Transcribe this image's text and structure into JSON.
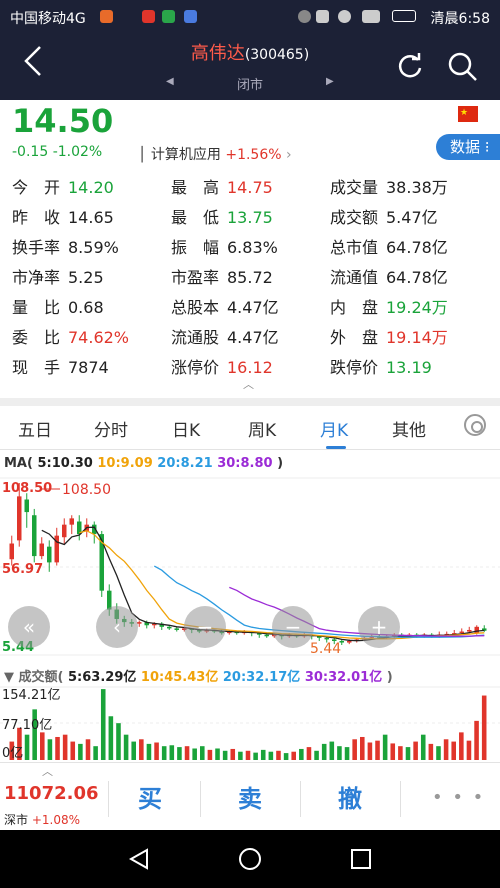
{
  "status_bar": {
    "carrier": "中国移动4G",
    "right": "清晨6:58",
    "net": "4G"
  },
  "header": {
    "stock_name": "高伟达",
    "stock_code": "(300465)",
    "market_status": "闭市",
    "back_icon": "chevron-left-icon",
    "refresh_icon": "refresh-icon",
    "search_icon": "search-icon"
  },
  "quote": {
    "price": "14.50",
    "change": "-0.15",
    "change_pct": "-1.02%",
    "sector_name": "计算机应用",
    "sector_pct": "+1.56%",
    "data_button": "数据",
    "flag_color": "#de2910",
    "rows": [
      [
        {
          "k": "今　开",
          "v": "14.20",
          "c": "dn"
        },
        {
          "k": "最　高",
          "v": "14.75",
          "c": "up"
        },
        {
          "k": "成交量",
          "v": "38.38万",
          "c": ""
        }
      ],
      [
        {
          "k": "昨　收",
          "v": "14.65",
          "c": ""
        },
        {
          "k": "最　低",
          "v": "13.75",
          "c": "dn"
        },
        {
          "k": "成交额",
          "v": "5.47亿",
          "c": ""
        }
      ],
      [
        {
          "k": "换手率",
          "v": "8.59%",
          "c": ""
        },
        {
          "k": "振　幅",
          "v": "6.83%",
          "c": ""
        },
        {
          "k": "总市值",
          "v": "64.78亿",
          "c": ""
        }
      ],
      [
        {
          "k": "市净率",
          "v": "5.25",
          "c": ""
        },
        {
          "k": "市盈率",
          "v": "85.72",
          "c": ""
        },
        {
          "k": "流通值",
          "v": "64.78亿",
          "c": ""
        }
      ],
      [
        {
          "k": "量　比",
          "v": "0.68",
          "c": ""
        },
        {
          "k": "总股本",
          "v": "4.47亿",
          "c": ""
        },
        {
          "k": "内　盘",
          "v": "19.24万",
          "c": "dn"
        }
      ],
      [
        {
          "k": "委　比",
          "v": "74.62%",
          "c": "up"
        },
        {
          "k": "流通股",
          "v": "4.47亿",
          "c": ""
        },
        {
          "k": "外　盘",
          "v": "19.14万",
          "c": "up"
        }
      ],
      [
        {
          "k": "现　手",
          "v": "7874",
          "c": ""
        },
        {
          "k": "涨停价",
          "v": "16.12",
          "c": "up"
        },
        {
          "k": "跌停价",
          "v": "13.19",
          "c": "dn"
        }
      ]
    ]
  },
  "tabs": [
    "五日",
    "分时",
    "日K",
    "周K",
    "月K",
    "其他"
  ],
  "active_tab": "月K",
  "ma_legend": {
    "prefix": "MA(",
    "ma5": "5:10.30",
    "ma10": "10:9.09",
    "ma20": "20:8.21",
    "ma30": "30:8.80",
    "suffix": ")"
  },
  "chart_labels": {
    "high_axis": "108.50",
    "high_mark": "108.50",
    "mid_axis": "56.97",
    "low_axis": "5.44",
    "low_mark": "5.44"
  },
  "vol_legend": {
    "prefix": "▼ 成交额(",
    "ma5": "5:63.29亿",
    "ma10": "10:45.43亿",
    "ma20": "20:32.17亿",
    "ma30": "30:32.01亿",
    "suffix": ")",
    "axis_top": "154.21亿",
    "axis_mid": "77.10亿",
    "axis_bot": "0亿"
  },
  "bottom": {
    "index_value": "11072.06",
    "index_name": "深市",
    "index_pct": "+1.08%",
    "buy": "买",
    "sell": "卖",
    "cancel": "撤",
    "more": "• • •"
  },
  "colors": {
    "up": "#e0352b",
    "down": "#1aa33a",
    "accent": "#2d7fd6",
    "ma5": "#222222",
    "ma10": "#f0a30a",
    "ma20": "#2b9be0",
    "ma30": "#9b2bd6"
  },
  "chart_data": {
    "type": "candlestick",
    "ylim": [
      5.44,
      108.5
    ],
    "candles": [
      {
        "o": 60,
        "c": 70,
        "h": 75,
        "l": 56
      },
      {
        "o": 72,
        "c": 100,
        "h": 108.5,
        "l": 68
      },
      {
        "o": 98,
        "c": 90,
        "h": 102,
        "l": 80
      },
      {
        "o": 88,
        "c": 62,
        "h": 92,
        "l": 58
      },
      {
        "o": 62,
        "c": 70,
        "h": 74,
        "l": 60
      },
      {
        "o": 68,
        "c": 58,
        "h": 72,
        "l": 52
      },
      {
        "o": 58,
        "c": 75,
        "h": 80,
        "l": 56
      },
      {
        "o": 74,
        "c": 82,
        "h": 86,
        "l": 70
      },
      {
        "o": 82,
        "c": 86,
        "h": 88,
        "l": 76
      },
      {
        "o": 84,
        "c": 76,
        "h": 88,
        "l": 72
      },
      {
        "o": 78,
        "c": 82,
        "h": 86,
        "l": 74
      },
      {
        "o": 82,
        "c": 76,
        "h": 84,
        "l": 70
      },
      {
        "o": 76,
        "c": 40,
        "h": 78,
        "l": 36
      },
      {
        "o": 40,
        "c": 28,
        "h": 44,
        "l": 24
      },
      {
        "o": 28,
        "c": 22,
        "h": 32,
        "l": 19
      },
      {
        "o": 22,
        "c": 20,
        "h": 24,
        "l": 17
      },
      {
        "o": 20,
        "c": 19,
        "h": 22,
        "l": 17
      },
      {
        "o": 19,
        "c": 20,
        "h": 21,
        "l": 17
      },
      {
        "o": 20,
        "c": 18,
        "h": 21,
        "l": 16
      },
      {
        "o": 18,
        "c": 19,
        "h": 20,
        "l": 16
      },
      {
        "o": 19,
        "c": 17,
        "h": 20,
        "l": 15
      },
      {
        "o": 17,
        "c": 16,
        "h": 18,
        "l": 15
      },
      {
        "o": 16,
        "c": 15,
        "h": 17,
        "l": 14
      },
      {
        "o": 15,
        "c": 16,
        "h": 17,
        "l": 14
      },
      {
        "o": 16,
        "c": 15,
        "h": 16,
        "l": 13
      },
      {
        "o": 15,
        "c": 14,
        "h": 16,
        "l": 13
      },
      {
        "o": 14,
        "c": 15,
        "h": 16,
        "l": 13
      },
      {
        "o": 15,
        "c": 14,
        "h": 15,
        "l": 13
      },
      {
        "o": 14,
        "c": 13,
        "h": 15,
        "l": 12
      },
      {
        "o": 13,
        "c": 14,
        "h": 15,
        "l": 12
      },
      {
        "o": 14,
        "c": 13,
        "h": 14,
        "l": 12
      },
      {
        "o": 13,
        "c": 14,
        "h": 15,
        "l": 12
      },
      {
        "o": 14,
        "c": 13,
        "h": 14,
        "l": 11
      },
      {
        "o": 13,
        "c": 12,
        "h": 13,
        "l": 10
      },
      {
        "o": 12,
        "c": 11,
        "h": 13,
        "l": 10
      },
      {
        "o": 11,
        "c": 12,
        "h": 13,
        "l": 10
      },
      {
        "o": 12,
        "c": 11,
        "h": 12,
        "l": 9
      },
      {
        "o": 11,
        "c": 12,
        "h": 13,
        "l": 10
      },
      {
        "o": 12,
        "c": 11,
        "h": 12,
        "l": 10
      },
      {
        "o": 11,
        "c": 12,
        "h": 13,
        "l": 10
      },
      {
        "o": 12,
        "c": 11,
        "h": 12,
        "l": 9
      },
      {
        "o": 11,
        "c": 10,
        "h": 11,
        "l": 8
      },
      {
        "o": 10,
        "c": 9,
        "h": 11,
        "l": 7
      },
      {
        "o": 9,
        "c": 8,
        "h": 10,
        "l": 6
      },
      {
        "o": 8,
        "c": 7,
        "h": 9,
        "l": 5.44
      },
      {
        "o": 7,
        "c": 8,
        "h": 9,
        "l": 6
      },
      {
        "o": 8,
        "c": 9,
        "h": 10,
        "l": 7
      },
      {
        "o": 9,
        "c": 10,
        "h": 11,
        "l": 8
      },
      {
        "o": 10,
        "c": 11,
        "h": 12,
        "l": 9
      },
      {
        "o": 11,
        "c": 10,
        "h": 12,
        "l": 9
      },
      {
        "o": 10,
        "c": 11,
        "h": 12,
        "l": 9
      },
      {
        "o": 11,
        "c": 12,
        "h": 13,
        "l": 10
      },
      {
        "o": 12,
        "c": 11,
        "h": 13,
        "l": 10
      },
      {
        "o": 11,
        "c": 12,
        "h": 13,
        "l": 10
      },
      {
        "o": 12,
        "c": 11,
        "h": 13,
        "l": 10
      },
      {
        "o": 11,
        "c": 12,
        "h": 13,
        "l": 10
      },
      {
        "o": 12,
        "c": 11,
        "h": 13,
        "l": 10
      },
      {
        "o": 11,
        "c": 12,
        "h": 14,
        "l": 10
      },
      {
        "o": 12,
        "c": 12.5,
        "h": 14,
        "l": 11
      },
      {
        "o": 12.5,
        "c": 13,
        "h": 15,
        "l": 11
      },
      {
        "o": 13,
        "c": 14,
        "h": 16,
        "l": 12
      },
      {
        "o": 14,
        "c": 15,
        "h": 17,
        "l": 13
      },
      {
        "o": 13,
        "c": 17,
        "h": 18,
        "l": 12
      },
      {
        "o": 16,
        "c": 14.5,
        "h": 18,
        "l": 13.75
      }
    ],
    "volume": [
      40,
      70,
      55,
      110,
      60,
      45,
      50,
      55,
      40,
      35,
      45,
      30,
      154,
      95,
      80,
      55,
      40,
      45,
      35,
      38,
      30,
      32,
      28,
      30,
      25,
      30,
      22,
      25,
      20,
      24,
      18,
      20,
      16,
      22,
      18,
      20,
      15,
      18,
      24,
      28,
      20,
      35,
      40,
      30,
      28,
      45,
      50,
      38,
      42,
      55,
      36,
      30,
      28,
      40,
      55,
      35,
      30,
      45,
      40,
      60,
      42,
      85,
      140
    ],
    "volume_ylim": [
      0,
      154.21
    ]
  }
}
